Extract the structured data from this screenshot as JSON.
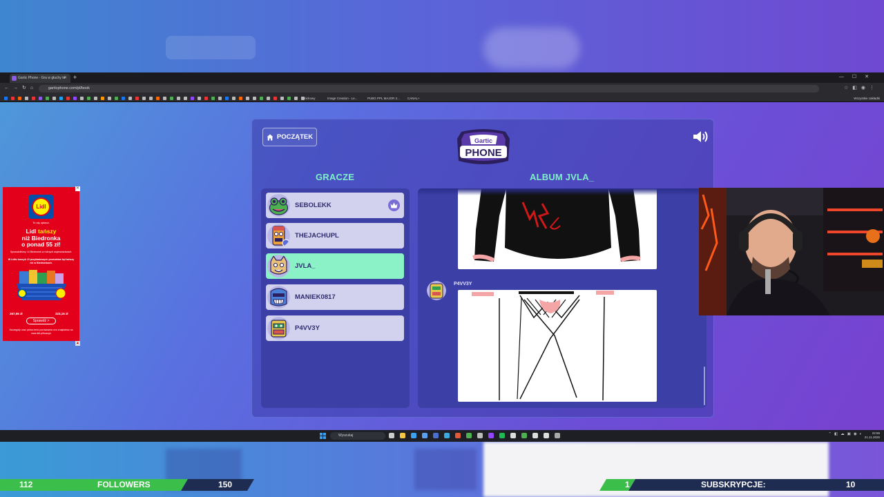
{
  "browser": {
    "tab_title": "Gartic Phone - Gra w głuchy te",
    "url": "garticphone.com/pl/book",
    "bookmarks": [
      "Kickowy",
      "Image Creation - Le...",
      "PUBG PPL MAJOR 2...",
      "CANAL+"
    ],
    "bookmarks_right": "Wszystkie zakładki"
  },
  "game": {
    "home_label": "POCZĄTEK",
    "logo_top": "Gartic",
    "logo_bottom": "PHONE",
    "players_title": "GRACZE",
    "album_title": "ALBUM JVLA_",
    "players": [
      {
        "name": "SEBOLEKK",
        "host": true,
        "active": false
      },
      {
        "name": "THEJACHUPL",
        "host": false,
        "active": false
      },
      {
        "name": "JVLA_",
        "host": false,
        "active": true
      },
      {
        "name": "MANIEK0817",
        "host": false,
        "active": false
      },
      {
        "name": "P4VV3Y",
        "host": false,
        "active": false
      }
    ],
    "drawing_author": "P4VV3Y"
  },
  "ad": {
    "brand": "Lidl",
    "tagline": "To się opłaca.",
    "headline_a": "Lidl ",
    "headline_b": "tańszy",
    "headline_c": "niż Biedronka",
    "headline_d": "o ponad 55 zł!",
    "small1": "Sprawdziliśmy 16 Biedronek w różnych województwach:",
    "small2": "W Lidlu koszyk 15 przykładowych produktów był tańszy niż w Biedronkach.",
    "price_left": "267,95 zł",
    "price_right": "323,15 zł",
    "cta": "Sprawdź >",
    "footnote": "Szczegóły oraz pełna treść porównania cen znajdziesz na www.lidl.pl/koszyk"
  },
  "taskbar": {
    "search_placeholder": "Wyszukaj",
    "time": "22:55",
    "date": "21.11.2025"
  },
  "stream": {
    "followers_current": "112",
    "followers_label": "FOLLOWERS",
    "followers_goal": "150",
    "subs_current": "1",
    "subs_label": "SUBSKRYPCJE:",
    "subs_goal": "10"
  },
  "colors": {
    "accent_green": "#7ff0c9",
    "active_player": "#8af2c6",
    "panel": "#3c3fa6",
    "lidl_red": "#e2001a",
    "bar_green": "#3bbf4a"
  }
}
